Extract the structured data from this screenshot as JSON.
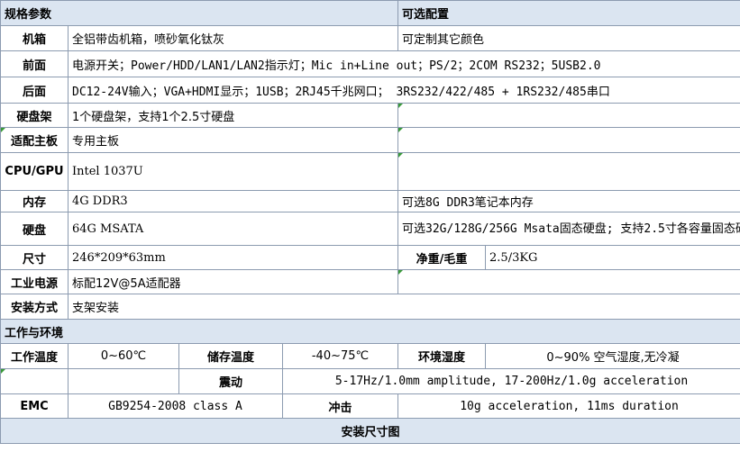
{
  "headers": {
    "spec": "规格参数",
    "options": "可选配置",
    "environment": "工作与环境",
    "install_drawing": "安装尺寸图"
  },
  "rows": {
    "chassis": {
      "label": "机箱",
      "value": "全铝带齿机箱，喷砂氧化钛灰",
      "option": "可定制其它颜色"
    },
    "front": {
      "label": "前面",
      "value": "电源开关；Power/HDD/LAN1/LAN2指示灯；Mic in+Line out；PS/2；2COM RS232；5USB2.0"
    },
    "rear": {
      "label": "后面",
      "value": "DC12-24V输入；VGA+HDMI显示；1USB；2RJ45千兆网口； 3RS232/422/485 + 1RS232/485串口"
    },
    "hdd_bay": {
      "label": "硬盘架",
      "value": "1个硬盘架，支持1个2.5寸硬盘",
      "option": ""
    },
    "board": {
      "label": "适配主板",
      "value": "专用主板",
      "option": ""
    },
    "cpu": {
      "label": "CPU/GPU",
      "value": "Intel 1037U",
      "option": ""
    },
    "memory": {
      "label": "内存",
      "value": "4G DDR3",
      "option": "可选8G DDR3笔记本内存"
    },
    "disk": {
      "label": "硬盘",
      "value": "64G MSATA",
      "option": "可选32G/128G/256G Msata固态硬盘;  支持2.5寸各容量固态硬盘及机械硬盘"
    },
    "size": {
      "label": "尺寸",
      "value": "246*209*63mm",
      "weight_label": "净重/毛重",
      "weight_value": "2.5/3KG"
    },
    "power": {
      "label": "工业电源",
      "value": "标配12V@5A适配器",
      "option": ""
    },
    "mount": {
      "label": "安装方式",
      "value": "支架安装"
    }
  },
  "env": {
    "work_temp_label": "工作温度",
    "work_temp": "0~60℃",
    "store_temp_label": "储存温度",
    "store_temp": "-40~75℃",
    "humidity_label": "环境湿度",
    "humidity": "0~90% 空气湿度,无冷凝",
    "vibration_label": "震动",
    "vibration": "5-17Hz/1.0mm amplitude, 17-200Hz/1.0g acceleration",
    "emc_label": "EMC",
    "emc": "GB9254-2008 class A",
    "shock_label": "冲击",
    "shock": "10g acceleration, 11ms duration"
  },
  "colors": {
    "header_bg": "#dbe5f1",
    "grid": "#8c9bb0",
    "marker": "#3a9a3a"
  }
}
